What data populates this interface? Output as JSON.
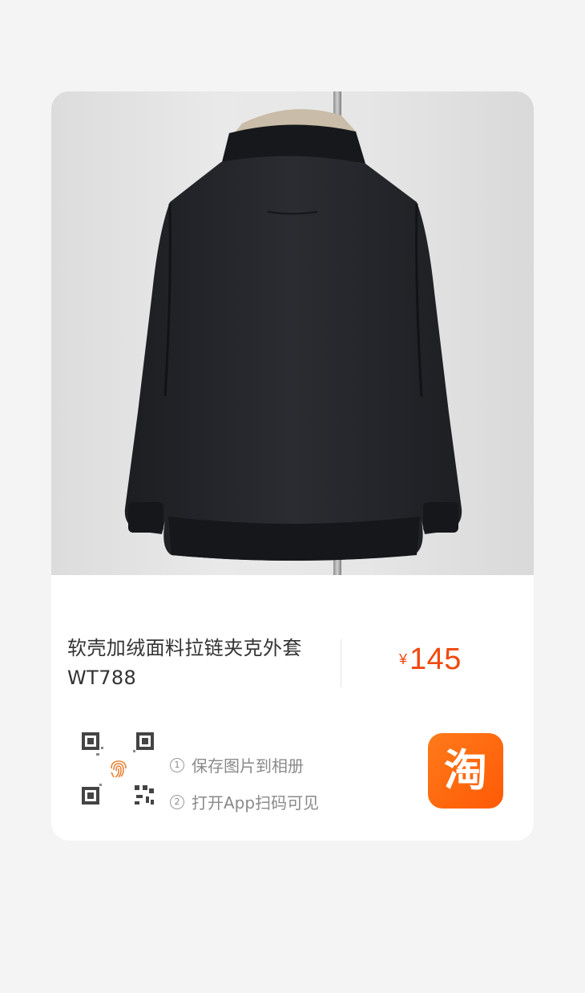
{
  "product": {
    "title_line1": "软壳加绒面料拉链夹克外套",
    "title_line2": "WT788",
    "currency_symbol": "¥",
    "price": "145",
    "image_alt": "black zip jacket on mannequin, back view"
  },
  "share": {
    "steps": [
      {
        "num": "1",
        "text": "保存图片到相册"
      },
      {
        "num": "2",
        "text": "打开App扫码可见"
      }
    ],
    "app_icon_glyph": "淘",
    "app_icon": "taobao-app-icon",
    "qr_icon": "qr-code-icon",
    "fingerprint_icon": "fingerprint-icon"
  },
  "colors": {
    "price": "#f0490e",
    "app_icon_bg": "#ff6a0d",
    "page_bg": "#f4f4f4"
  }
}
